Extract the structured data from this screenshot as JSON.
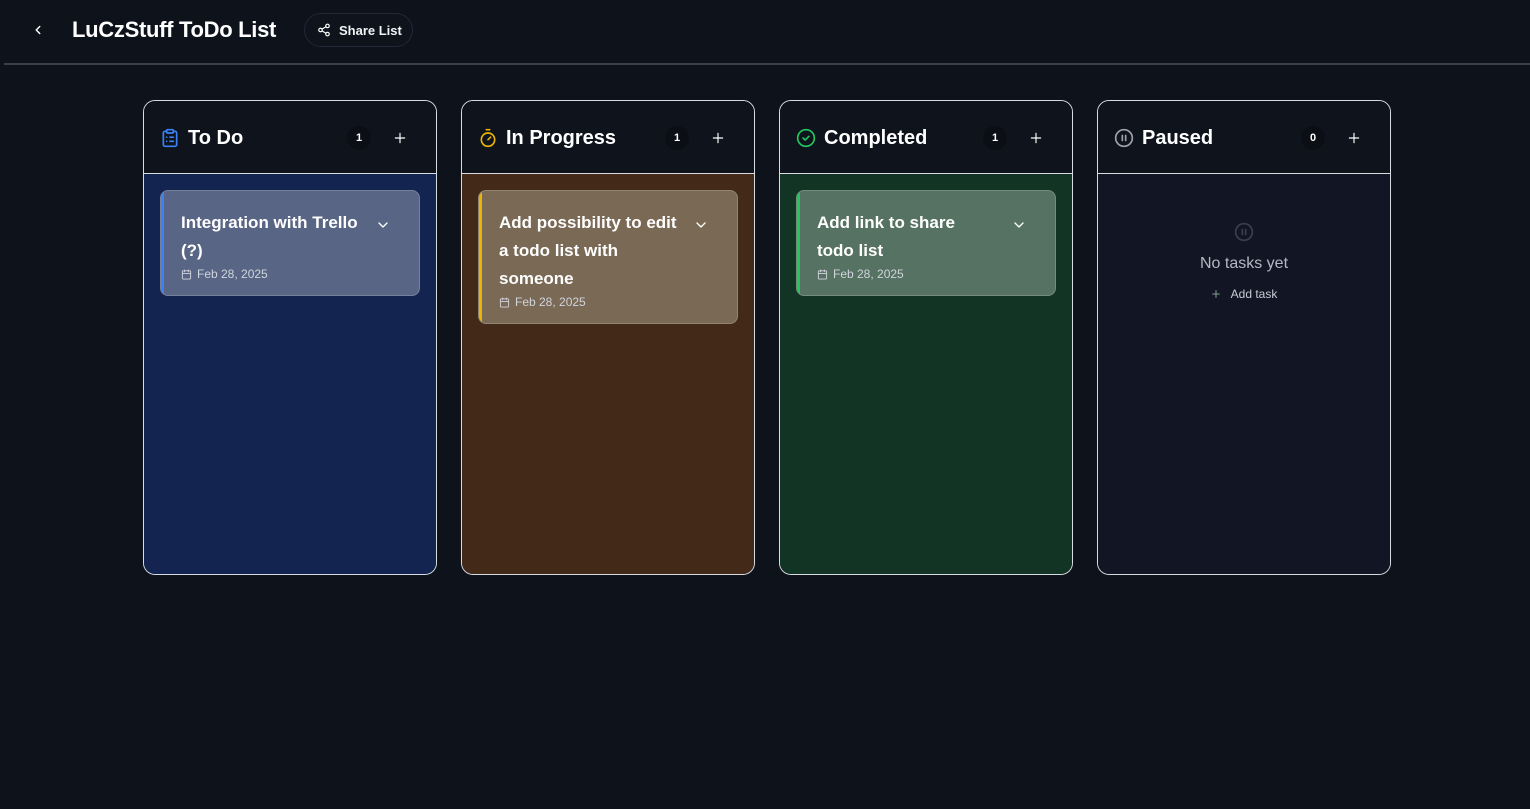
{
  "header": {
    "title": "LuCzStuff ToDo List",
    "share_label": "Share List"
  },
  "columns": [
    {
      "id": "todo",
      "title": "To Do",
      "count": "1",
      "icon": "clipboard-list-icon",
      "icon_color": "#3b82f6",
      "body_bg": "#142450",
      "card_bg": "#586584",
      "accent": "#3b82f6",
      "tasks": [
        {
          "title": "Integration with Trello (?)",
          "date": "Feb 28, 2025"
        }
      ]
    },
    {
      "id": "in-progress",
      "title": "In Progress",
      "count": "1",
      "icon": "stopwatch-icon",
      "icon_color": "#eab308",
      "body_bg": "#432a18",
      "card_bg": "#7a6955",
      "accent": "#eab308",
      "tasks": [
        {
          "title": "Add possibility to edit a todo list with someone",
          "date": "Feb 28, 2025"
        }
      ]
    },
    {
      "id": "completed",
      "title": "Completed",
      "count": "1",
      "icon": "check-circle-icon",
      "icon_color": "#22c55e",
      "body_bg": "#123424",
      "card_bg": "#567262",
      "accent": "#22c55e",
      "tasks": [
        {
          "title": "Add link to share todo list",
          "date": "Feb 28, 2025"
        }
      ]
    },
    {
      "id": "paused",
      "title": "Paused",
      "count": "0",
      "icon": "pause-circle-icon",
      "icon_color": "#9ca3af",
      "body_bg": "#121624",
      "tasks": [],
      "empty_text": "No tasks yet",
      "empty_add_label": "Add task"
    }
  ]
}
